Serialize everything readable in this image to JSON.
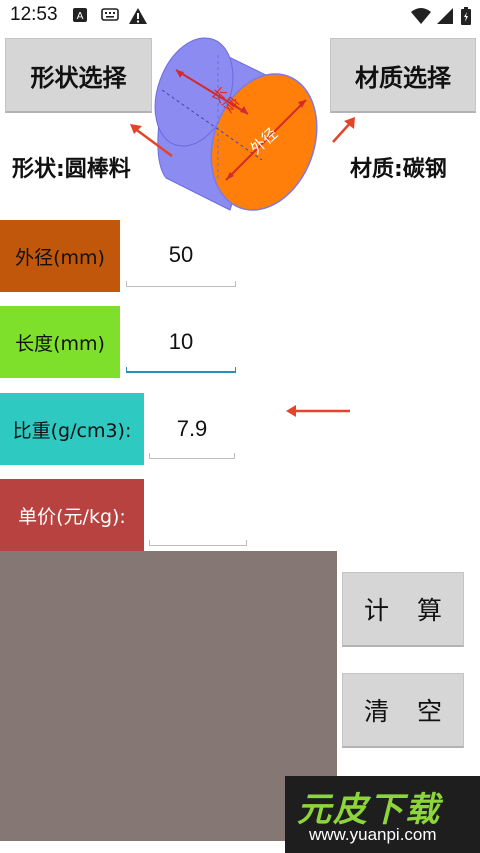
{
  "status_bar": {
    "time": "12:53"
  },
  "header": {
    "shape_button_label": "形状选择",
    "material_button_label": "材质选择",
    "shape_text": "形状:圆棒料",
    "material_text": "材质:碳钢"
  },
  "diagram": {
    "length_label": "长度",
    "diameter_label": "外径"
  },
  "rows": [
    {
      "label": "外径(mm)",
      "value": "50"
    },
    {
      "label": "长度(mm)",
      "value": "10"
    },
    {
      "label": "比重(g/cm3):",
      "value": "7.9"
    },
    {
      "label": "单价(元/kg):",
      "value": ""
    }
  ],
  "actions": {
    "calculate_label": "计 算",
    "clear_label": "清 空"
  },
  "watermark": {
    "brand": "元皮下载",
    "url": "www.yuanpi.com"
  },
  "colors": {
    "outer_diameter_bg": "#c0570a",
    "length_bg": "#7ee02a",
    "density_bg": "#2ec9c0",
    "price_bg": "#b7423f",
    "result_bg": "#857874",
    "arrow": "#e2452a"
  }
}
